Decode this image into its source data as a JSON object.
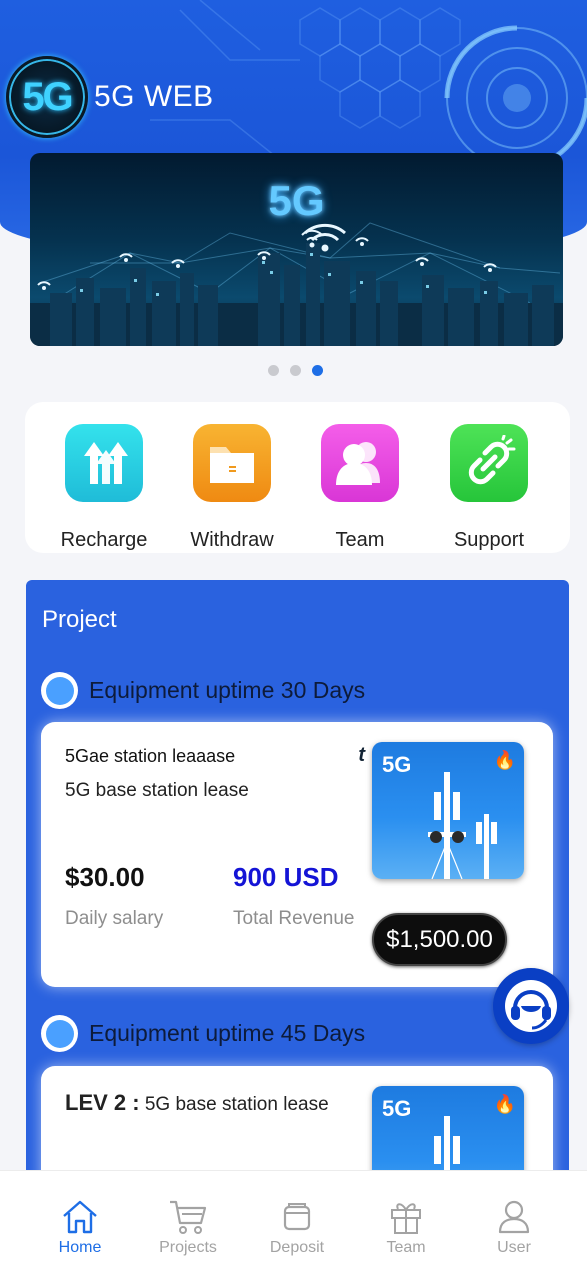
{
  "brand": {
    "name": "5G WEB",
    "logo_text": "5G"
  },
  "banner": {
    "title": "5G",
    "slides": 3,
    "active_slide": 3
  },
  "shortcuts": [
    {
      "label": "Recharge",
      "icon": "upload-arrows-icon",
      "color": "#2fd3e3"
    },
    {
      "label": "Withdraw",
      "icon": "folder-icon",
      "color": "#f49a1c"
    },
    {
      "label": "Team",
      "icon": "people-icon",
      "color": "#e84ce0"
    },
    {
      "label": "Support",
      "icon": "link-icon",
      "color": "#3bd14a"
    }
  ],
  "project": {
    "title": "Project",
    "sections": [
      {
        "heading": "Equipment uptime 30 Days",
        "card": {
          "overlay_text": "5Gae station leaaase",
          "overlay_mark": "t",
          "name": "5G base station lease",
          "thumb_tag": "5G",
          "daily_value": "$30.00",
          "daily_label": "Daily salary",
          "total_value": "900 USD",
          "total_label": "Total Revenue",
          "price": "$1,500.00"
        }
      },
      {
        "heading": "Equipment uptime 45 Days",
        "card": {
          "level": "LEV 2 :",
          "name": "5G base station lease",
          "thumb_tag": "5G"
        }
      }
    ]
  },
  "bottom_nav": [
    {
      "label": "Home",
      "icon": "home-icon",
      "active": true
    },
    {
      "label": "Projects",
      "icon": "cart-icon",
      "active": false
    },
    {
      "label": "Deposit",
      "icon": "wallet-icon",
      "active": false
    },
    {
      "label": "Team",
      "icon": "gift-icon",
      "active": false
    },
    {
      "label": "User",
      "icon": "user-icon",
      "active": false
    }
  ],
  "colors": {
    "primary": "#1e6ee6",
    "header_blue": "#1f5fe0",
    "panel_blue": "#2a62df",
    "total_revenue": "#1414d6"
  }
}
